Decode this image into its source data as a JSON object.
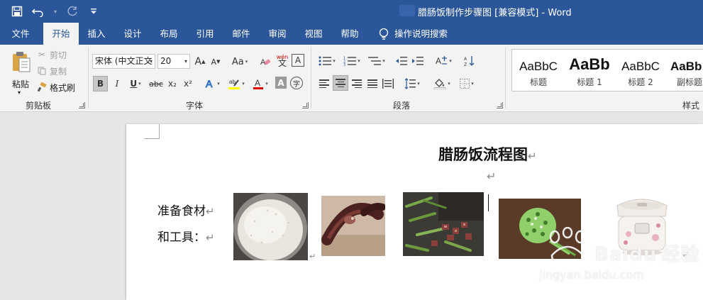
{
  "app": {
    "title": "腊肠饭制作步骤图 [兼容模式]  -  Word"
  },
  "qat": {
    "save_icon": "save-icon",
    "undo_icon": "undo-icon",
    "redo_icon": "redo-icon",
    "customize_icon": "customize-qat-icon"
  },
  "tabs": [
    {
      "label": "文件"
    },
    {
      "label": "开始"
    },
    {
      "label": "插入"
    },
    {
      "label": "设计"
    },
    {
      "label": "布局"
    },
    {
      "label": "引用"
    },
    {
      "label": "邮件"
    },
    {
      "label": "审阅"
    },
    {
      "label": "视图"
    },
    {
      "label": "帮助"
    },
    {
      "label": "操作说明搜索"
    }
  ],
  "ribbon": {
    "clipboard": {
      "paste": "粘贴",
      "cut": "剪切",
      "copy": "复制",
      "format_painter": "格式刷",
      "group_label": "剪贴板"
    },
    "font": {
      "font_name": "宋体 (中文正文",
      "font_size": "20",
      "group_label": "字体",
      "bold": "B",
      "italic": "I",
      "underline": "U",
      "strike": "abc",
      "subscript": "x₂",
      "superscript": "x²",
      "change_case": "Aa",
      "grow": "A",
      "shrink": "A",
      "phonetic": "wén",
      "phonetic_base": "文",
      "char_border": "A",
      "char_shading": "A",
      "enclose": "字"
    },
    "paragraph": {
      "group_label": "段落"
    },
    "styles": {
      "group_label": "样式",
      "items": [
        {
          "sample": "AaBbC",
          "name": "标题"
        },
        {
          "sample": "AaBb",
          "name": "标题 1"
        },
        {
          "sample": "AaBbC",
          "name": "标题 2"
        },
        {
          "sample": "AaBb",
          "name": "副标题"
        }
      ]
    }
  },
  "document": {
    "title": "腊肠饭流程图",
    "para_mark": "↵",
    "prep_line1": "准备食材",
    "prep_line2": "和工具：",
    "small_mark": "↵"
  },
  "photos": [
    {
      "name": "rice",
      "subject": "raw-rice"
    },
    {
      "name": "sausage",
      "subject": "chinese-sausage"
    },
    {
      "name": "ingredients",
      "subject": "beans-and-sausage"
    },
    {
      "name": "scallions",
      "subject": "chopped-scallions"
    },
    {
      "name": "rice-cooker",
      "subject": "rice-cooker"
    }
  ],
  "watermark": {
    "brand": "Baidu",
    "suffix": "经验",
    "url": "jingyan.baidu.com"
  },
  "colors": {
    "ribbon_blue": "#2b579a",
    "ribbon_bg": "#f3f3f3",
    "highlight_yellow": "#ffff00",
    "font_red": "#e00000"
  }
}
